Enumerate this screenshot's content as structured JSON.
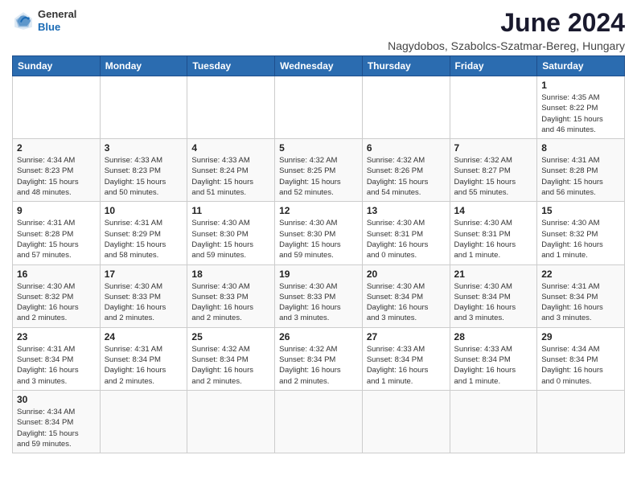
{
  "header": {
    "logo_line1": "General",
    "logo_line2": "Blue",
    "month_title": "June 2024",
    "location": "Nagydobos, Szabolcs-Szatmar-Bereg, Hungary"
  },
  "weekdays": [
    "Sunday",
    "Monday",
    "Tuesday",
    "Wednesday",
    "Thursday",
    "Friday",
    "Saturday"
  ],
  "weeks": [
    [
      {
        "day": "",
        "info": ""
      },
      {
        "day": "",
        "info": ""
      },
      {
        "day": "",
        "info": ""
      },
      {
        "day": "",
        "info": ""
      },
      {
        "day": "",
        "info": ""
      },
      {
        "day": "",
        "info": ""
      },
      {
        "day": "1",
        "info": "Sunrise: 4:35 AM\nSunset: 8:22 PM\nDaylight: 15 hours\nand 46 minutes."
      }
    ],
    [
      {
        "day": "2",
        "info": "Sunrise: 4:34 AM\nSunset: 8:23 PM\nDaylight: 15 hours\nand 48 minutes."
      },
      {
        "day": "3",
        "info": "Sunrise: 4:33 AM\nSunset: 8:23 PM\nDaylight: 15 hours\nand 50 minutes."
      },
      {
        "day": "4",
        "info": "Sunrise: 4:33 AM\nSunset: 8:24 PM\nDaylight: 15 hours\nand 51 minutes."
      },
      {
        "day": "5",
        "info": "Sunrise: 4:32 AM\nSunset: 8:25 PM\nDaylight: 15 hours\nand 52 minutes."
      },
      {
        "day": "6",
        "info": "Sunrise: 4:32 AM\nSunset: 8:26 PM\nDaylight: 15 hours\nand 54 minutes."
      },
      {
        "day": "7",
        "info": "Sunrise: 4:32 AM\nSunset: 8:27 PM\nDaylight: 15 hours\nand 55 minutes."
      },
      {
        "day": "8",
        "info": "Sunrise: 4:31 AM\nSunset: 8:28 PM\nDaylight: 15 hours\nand 56 minutes."
      }
    ],
    [
      {
        "day": "9",
        "info": "Sunrise: 4:31 AM\nSunset: 8:28 PM\nDaylight: 15 hours\nand 57 minutes."
      },
      {
        "day": "10",
        "info": "Sunrise: 4:31 AM\nSunset: 8:29 PM\nDaylight: 15 hours\nand 58 minutes."
      },
      {
        "day": "11",
        "info": "Sunrise: 4:30 AM\nSunset: 8:30 PM\nDaylight: 15 hours\nand 59 minutes."
      },
      {
        "day": "12",
        "info": "Sunrise: 4:30 AM\nSunset: 8:30 PM\nDaylight: 15 hours\nand 59 minutes."
      },
      {
        "day": "13",
        "info": "Sunrise: 4:30 AM\nSunset: 8:31 PM\nDaylight: 16 hours\nand 0 minutes."
      },
      {
        "day": "14",
        "info": "Sunrise: 4:30 AM\nSunset: 8:31 PM\nDaylight: 16 hours\nand 1 minute."
      },
      {
        "day": "15",
        "info": "Sunrise: 4:30 AM\nSunset: 8:32 PM\nDaylight: 16 hours\nand 1 minute."
      }
    ],
    [
      {
        "day": "16",
        "info": "Sunrise: 4:30 AM\nSunset: 8:32 PM\nDaylight: 16 hours\nand 2 minutes."
      },
      {
        "day": "17",
        "info": "Sunrise: 4:30 AM\nSunset: 8:33 PM\nDaylight: 16 hours\nand 2 minutes."
      },
      {
        "day": "18",
        "info": "Sunrise: 4:30 AM\nSunset: 8:33 PM\nDaylight: 16 hours\nand 2 minutes."
      },
      {
        "day": "19",
        "info": "Sunrise: 4:30 AM\nSunset: 8:33 PM\nDaylight: 16 hours\nand 3 minutes."
      },
      {
        "day": "20",
        "info": "Sunrise: 4:30 AM\nSunset: 8:34 PM\nDaylight: 16 hours\nand 3 minutes."
      },
      {
        "day": "21",
        "info": "Sunrise: 4:30 AM\nSunset: 8:34 PM\nDaylight: 16 hours\nand 3 minutes."
      },
      {
        "day": "22",
        "info": "Sunrise: 4:31 AM\nSunset: 8:34 PM\nDaylight: 16 hours\nand 3 minutes."
      }
    ],
    [
      {
        "day": "23",
        "info": "Sunrise: 4:31 AM\nSunset: 8:34 PM\nDaylight: 16 hours\nand 3 minutes."
      },
      {
        "day": "24",
        "info": "Sunrise: 4:31 AM\nSunset: 8:34 PM\nDaylight: 16 hours\nand 2 minutes."
      },
      {
        "day": "25",
        "info": "Sunrise: 4:32 AM\nSunset: 8:34 PM\nDaylight: 16 hours\nand 2 minutes."
      },
      {
        "day": "26",
        "info": "Sunrise: 4:32 AM\nSunset: 8:34 PM\nDaylight: 16 hours\nand 2 minutes."
      },
      {
        "day": "27",
        "info": "Sunrise: 4:33 AM\nSunset: 8:34 PM\nDaylight: 16 hours\nand 1 minute."
      },
      {
        "day": "28",
        "info": "Sunrise: 4:33 AM\nSunset: 8:34 PM\nDaylight: 16 hours\nand 1 minute."
      },
      {
        "day": "29",
        "info": "Sunrise: 4:34 AM\nSunset: 8:34 PM\nDaylight: 16 hours\nand 0 minutes."
      }
    ],
    [
      {
        "day": "30",
        "info": "Sunrise: 4:34 AM\nSunset: 8:34 PM\nDaylight: 15 hours\nand 59 minutes."
      },
      {
        "day": "",
        "info": ""
      },
      {
        "day": "",
        "info": ""
      },
      {
        "day": "",
        "info": ""
      },
      {
        "day": "",
        "info": ""
      },
      {
        "day": "",
        "info": ""
      },
      {
        "day": "",
        "info": ""
      }
    ]
  ]
}
